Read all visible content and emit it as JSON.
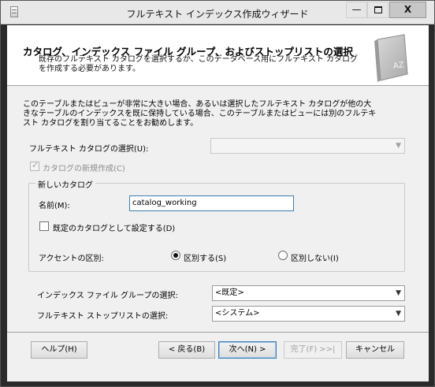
{
  "window": {
    "title": "フルテキスト インデックス作成ウィザード",
    "min_glyph": "—",
    "close_glyph": "X"
  },
  "header": {
    "title": "カタログ、インデックス ファイル グループ、およびストップリストの選択",
    "description": "既存のフルテキスト カタログを選択するか、このデータベース用にフルテキスト カタログを作成する必要があります。",
    "book_label": "AZ"
  },
  "info_text": "このテーブルまたはビューが非常に大きい場合、あるいは選択したフルテキスト カタログが他の大きなテーブルのインデックスを既に保持している場合、このテーブルまたはビューには別のフルテキスト カタログを割り当てることをお勧めします。",
  "catalog_select": {
    "label": "フルテキスト カタログの選択(U):",
    "value": "",
    "arrow": "▼"
  },
  "new_catalog_checkbox": {
    "label": "カタログの新規作成(C)",
    "checked": true,
    "mark": "✓"
  },
  "new_catalog_group": {
    "title": "新しいカタログ",
    "name_label": "名前(M):",
    "name_value": "catalog_working",
    "default_label": "既定のカタログとして設定する(D)",
    "accent_label": "アクセントの区別:",
    "accent_sensitive": "区別する(S)",
    "accent_insensitive": "区別しない(I)"
  },
  "filegroup_select": {
    "label": "インデックス ファイル グループの選択:",
    "value": "<既定>",
    "arrow": "▼"
  },
  "stoplist_select": {
    "label": "フルテキスト ストップリストの選択:",
    "value": "<システム>",
    "arrow": "▼"
  },
  "buttons": {
    "help": "ヘルプ(H)",
    "back": "< 戻る(B)",
    "next": "次へ(N) >",
    "finish": "完了(F) >>|",
    "cancel": "キャンセル"
  }
}
